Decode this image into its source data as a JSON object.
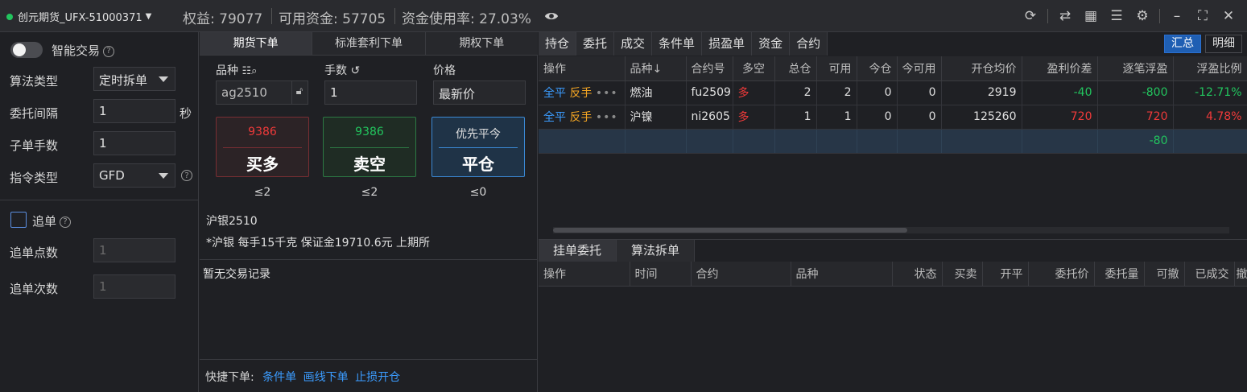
{
  "titlebar": {
    "account": "创元期货_UFX-51000371",
    "equity": "权益: 79077",
    "available": "可用资金: 57705",
    "usage": "资金使用率: 27.03%"
  },
  "left": {
    "smart_label": "智能交易",
    "algo_label": "算法类型",
    "algo_value": "定时拆单",
    "interval_label": "委托间隔",
    "interval_value": "1",
    "interval_unit": "秒",
    "child_label": "子单手数",
    "child_value": "1",
    "instr_label": "指令类型",
    "instr_value": "GFD",
    "chase_label": "追单",
    "chase_pts_label": "追单点数",
    "chase_pts_value": "1",
    "chase_cnt_label": "追单次数",
    "chase_cnt_value": "1"
  },
  "mid": {
    "tabs": [
      "期货下单",
      "标准套利下单",
      "期权下单"
    ],
    "symbol_label": "品种",
    "symbol_value": "ag2510",
    "qty_label": "手数",
    "qty_value": "1",
    "price_label": "价格",
    "price_value": "最新价",
    "buy": {
      "price": "9386",
      "label": "买多",
      "limit": "≤2"
    },
    "sell": {
      "price": "9386",
      "label": "卖空",
      "limit": "≤2"
    },
    "close": {
      "price": "优先平今",
      "label": "平仓",
      "limit": "≤0"
    },
    "contract_name": "沪银2510",
    "contract_info": "*沪银 每手15千克 保证金19710.6元 上期所",
    "no_records": "暂无交易记录",
    "quick_label": "快捷下单:",
    "quick_links": [
      "条件单",
      "画线下单",
      "止损开仓"
    ]
  },
  "right": {
    "tabs": [
      "持仓",
      "委托",
      "成交",
      "条件单",
      "损盈单",
      "资金",
      "合约"
    ],
    "btn_summary": "汇总",
    "btn_detail": "明细",
    "pos_headers": [
      "操作",
      "品种↓",
      "合约号",
      "多空",
      "总仓",
      "可用",
      "今仓",
      "今可用",
      "开仓均价",
      "盈利价差",
      "逐笔浮盈",
      "浮盈比例"
    ],
    "positions": [
      {
        "op1": "全平",
        "op2": "反手",
        "dots": "•••",
        "name": "燃油",
        "code": "fu2509",
        "side": "多",
        "total": "2",
        "avail": "2",
        "today": "0",
        "today_avail": "0",
        "avg": "2919",
        "spread": "-40",
        "pnl": "-800",
        "ratio": "-12.71%"
      },
      {
        "op1": "全平",
        "op2": "反手",
        "dots": "•••",
        "name": "沪镍",
        "code": "ni2605",
        "side": "多",
        "total": "1",
        "avail": "1",
        "today": "0",
        "today_avail": "0",
        "avg": "125260",
        "spread": "720",
        "pnl": "720",
        "ratio": "4.78%"
      }
    ],
    "sum_pnl": "-80",
    "bottom_tabs": [
      "挂单委托",
      "算法拆单"
    ],
    "order_headers": [
      "操作",
      "时间",
      "合约",
      "品种",
      "状态",
      "买卖",
      "开平",
      "委托价",
      "委托量",
      "可撤",
      "已成交",
      "撤"
    ]
  },
  "colors": {
    "red": "#f03a3a",
    "green": "#22c55e",
    "blue": "#3b9cff",
    "orange": "#f5a623",
    "accent": "#1f5fb3"
  }
}
